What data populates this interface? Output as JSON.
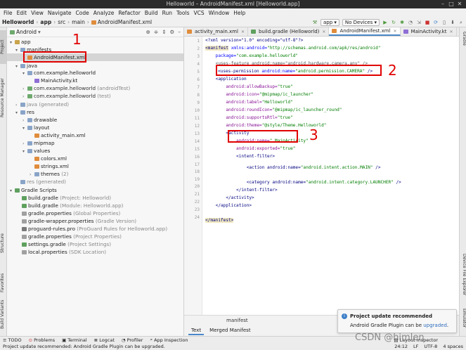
{
  "window": {
    "title": "Helloworld – AndroidManifest.xml [Helloworld.app]"
  },
  "menu": [
    "File",
    "Edit",
    "View",
    "Navigate",
    "Code",
    "Analyze",
    "Refactor",
    "Build",
    "Run",
    "Tools",
    "VCS",
    "Window",
    "Help"
  ],
  "breadcrumb": [
    "Helloworld",
    "app",
    "src",
    "main",
    "AndroidManifest.xml"
  ],
  "toolbar": {
    "run_config": "app",
    "device": "No Devices"
  },
  "project_panel": {
    "view_mode": "Android",
    "tree": [
      {
        "label": "app",
        "extra": ""
      },
      {
        "label": "manifests",
        "extra": ""
      },
      {
        "label": "AndroidManifest.xml",
        "extra": ""
      },
      {
        "label": "java",
        "extra": ""
      },
      {
        "label": "com.example.helloworld",
        "extra": ""
      },
      {
        "label": "MainActivity.kt",
        "extra": ""
      },
      {
        "label": "com.example.helloworld",
        "extra": "(androidTest)"
      },
      {
        "label": "com.example.helloworld",
        "extra": "(test)"
      },
      {
        "label": "java",
        "extra": "(generated)"
      },
      {
        "label": "res",
        "extra": ""
      },
      {
        "label": "drawable",
        "extra": ""
      },
      {
        "label": "layout",
        "extra": ""
      },
      {
        "label": "activity_main.xml",
        "extra": ""
      },
      {
        "label": "mipmap",
        "extra": ""
      },
      {
        "label": "values",
        "extra": ""
      },
      {
        "label": "colors.xml",
        "extra": ""
      },
      {
        "label": "strings.xml",
        "extra": ""
      },
      {
        "label": "themes",
        "extra": "(2)"
      },
      {
        "label": "res",
        "extra": "(generated)"
      },
      {
        "label": "Gradle Scripts",
        "extra": ""
      },
      {
        "label": "build.gradle",
        "extra": "(Project: Helloworld)"
      },
      {
        "label": "build.gradle",
        "extra": "(Module: Helloworld.app)"
      },
      {
        "label": "gradle.properties",
        "extra": "(Global Properties)"
      },
      {
        "label": "gradle-wrapper.properties",
        "extra": "(Gradle Version)"
      },
      {
        "label": "proguard-rules.pro",
        "extra": "(ProGuard Rules for Helloworld.app)"
      },
      {
        "label": "gradle.properties",
        "extra": "(Project Properties)"
      },
      {
        "label": "settings.gradle",
        "extra": "(Project Settings)"
      },
      {
        "label": "local.properties",
        "extra": "(SDK Location)"
      }
    ]
  },
  "left_tool_tabs": [
    "Project",
    "Resource Manager",
    "Structure",
    "Favorites",
    "Build Variants"
  ],
  "right_tool_tabs": [
    "Gradle",
    "Device File Explorer",
    "Emulator"
  ],
  "editor_tabs": [
    {
      "label": "activity_main.xml",
      "active": false
    },
    {
      "label": "build.gradle (Helloworld)",
      "active": false
    },
    {
      "label": "AndroidManifest.xml",
      "active": true
    },
    {
      "label": "MainActivity.kt",
      "active": false
    },
    {
      "label": "buil",
      "active": false
    }
  ],
  "code_lines": {
    "l1": "<?xml version=\"1.0\" encoding=\"utf-8\"?>",
    "l2a": "<manifest",
    "l2b": " xmlns:android=",
    "l2c": "\"http://schemas.android.com/apk/res/android\"",
    "l3a": "    package=",
    "l3b": "\"com.example.helloworld\"",
    "l4": "    <uses-feature android:name=\"android.hardware.camera.any\" />",
    "l5a": "<uses-permission",
    "l5b": " android:name=",
    "l5c": "\"android.permission.CAMERA\"",
    "l5d": " />",
    "l6": "    <application",
    "l7a": "        android:allowBackup=",
    "l7b": "\"true\"",
    "l8a": "        android:icon=",
    "l8b": "\"@mipmap/ic_launcher\"",
    "l9a": "        android:label=",
    "l9b": "\"Helloworld\"",
    "l10a": "        android:roundIcon=",
    "l10b": "\"@mipmap/ic_launcher_round\"",
    "l11a": "        android:supportsRtl=",
    "l11b": "\"true\"",
    "l12a": "        android:theme=",
    "l12b": "\"@style/Theme.Helloworld\"",
    "l13": "        <activity",
    "l14a": "            android:name=",
    "l14b": "\".MainActivity\"",
    "l15a": "            android:exported=",
    "l15b": "\"true\"",
    "l16": "            <intent-filter>",
    "l17a": "                <action android:name=",
    "l17b": "\"android.intent.action.MAIN\"",
    "l17c": " />",
    "l18a": "                <category android:name=",
    "l18b": "\"android.intent.category.LAUNCHER\"",
    "l18c": " />",
    "l19": "            </intent-filter>",
    "l20": "        </activity>",
    "l21": "    </application>",
    "l22": "</manifest>"
  },
  "line_numbers": [
    "1",
    "2",
    "3",
    "4",
    "5",
    "6",
    "7",
    "8",
    "9",
    "10",
    "11",
    "12",
    "13",
    "14",
    "15",
    "16",
    "17",
    "18",
    "19",
    "20",
    "21",
    "22",
    "23",
    "24"
  ],
  "annotations": [
    "1",
    "2",
    "3"
  ],
  "editor_breadcrumb": "manifest",
  "editor_bottom_tabs": [
    "Text",
    "Merged Manifest"
  ],
  "notification": {
    "title": "Project update recommended",
    "body_prefix": "Android Gradle Plugin can be ",
    "link": "upgraded",
    "body_suffix": "."
  },
  "bottom_tools": [
    "TODO",
    "Problems",
    "Terminal",
    "Logcat",
    "Profiler",
    "App Inspection",
    "Layout Inspector"
  ],
  "status": {
    "message": "Project update recommended: Android Gradle Plugin can be upgraded.",
    "position": "24:12",
    "line_sep": "LF",
    "encoding": "UTF-8",
    "indent": "4 spaces"
  },
  "watermark": "CSDN @himlen",
  "colors": {
    "accent": "#4a88c7",
    "annotation": "#e00000"
  }
}
